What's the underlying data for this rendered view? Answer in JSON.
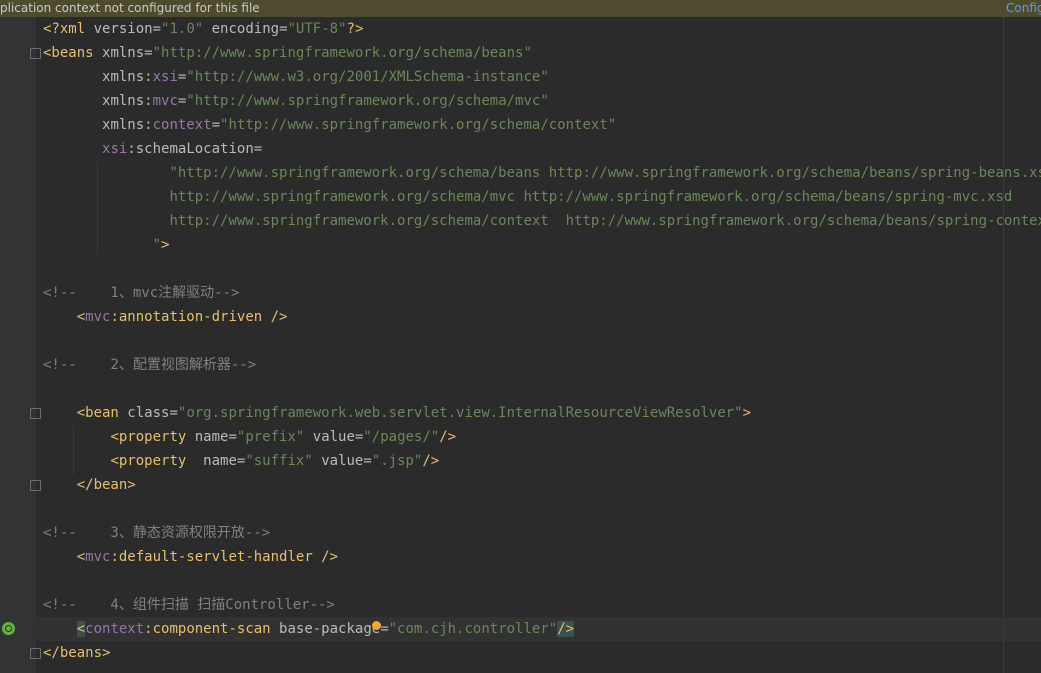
{
  "banner": {
    "message": "plication context not configured for this file",
    "configure_label": "Config"
  },
  "lines": [
    {
      "parts": [
        {
          "c": "tag",
          "t": "<?xml "
        },
        {
          "c": "attr",
          "t": "version"
        },
        {
          "c": "txt",
          "t": "="
        },
        {
          "c": "val",
          "t": "\"1.0\""
        },
        {
          "c": "txt",
          "t": " "
        },
        {
          "c": "attr",
          "t": "encoding"
        },
        {
          "c": "txt",
          "t": "="
        },
        {
          "c": "val",
          "t": "\"UTF-8\""
        },
        {
          "c": "tag",
          "t": "?>"
        }
      ]
    },
    {
      "parts": [
        {
          "c": "tag",
          "t": "<beans "
        },
        {
          "c": "attr",
          "t": "xmlns"
        },
        {
          "c": "txt",
          "t": "="
        },
        {
          "c": "val",
          "t": "\"http://www.springframework.org/schema/beans\""
        }
      ]
    },
    {
      "parts": [
        {
          "c": "txt",
          "t": "       "
        },
        {
          "c": "attr",
          "t": "xmlns:"
        },
        {
          "c": "ns",
          "t": "xsi"
        },
        {
          "c": "txt",
          "t": "="
        },
        {
          "c": "val",
          "t": "\"http://www.w3.org/2001/XMLSchema-instance\""
        }
      ]
    },
    {
      "parts": [
        {
          "c": "txt",
          "t": "       "
        },
        {
          "c": "attr",
          "t": "xmlns:"
        },
        {
          "c": "ns",
          "t": "mvc"
        },
        {
          "c": "txt",
          "t": "="
        },
        {
          "c": "val",
          "t": "\"http://www.springframework.org/schema/mvc\""
        }
      ]
    },
    {
      "parts": [
        {
          "c": "txt",
          "t": "       "
        },
        {
          "c": "attr",
          "t": "xmlns:"
        },
        {
          "c": "ns",
          "t": "context"
        },
        {
          "c": "txt",
          "t": "="
        },
        {
          "c": "val",
          "t": "\"http://www.springframework.org/schema/context\""
        }
      ]
    },
    {
      "parts": [
        {
          "c": "txt",
          "t": "       "
        },
        {
          "c": "ns",
          "t": "xsi"
        },
        {
          "c": "attr",
          "t": ":schemaLocation"
        },
        {
          "c": "txt",
          "t": "="
        }
      ]
    },
    {
      "parts": [
        {
          "c": "txt",
          "t": "               "
        },
        {
          "c": "val",
          "t": "\"http://www.springframework.org/schema/beans http://www.springframework.org/schema/beans/spring-beans.xsd"
        }
      ]
    },
    {
      "parts": [
        {
          "c": "txt",
          "t": "               "
        },
        {
          "c": "val",
          "t": "http://www.springframework.org/schema/mvc http://www.springframework.org/schema/beans/spring-mvc.xsd"
        }
      ]
    },
    {
      "parts": [
        {
          "c": "txt",
          "t": "               "
        },
        {
          "c": "val",
          "t": "http://www.springframework.org/schema/context  http://www.springframework.org/schema/beans/spring-context.xsd"
        }
      ]
    },
    {
      "parts": [
        {
          "c": "txt",
          "t": "             "
        },
        {
          "c": "val",
          "t": "\""
        },
        {
          "c": "tag",
          "t": ">"
        }
      ]
    },
    {
      "parts": []
    },
    {
      "parts": [
        {
          "c": "cmt",
          "t": "<!--    1、mvc注解驱动-->"
        }
      ]
    },
    {
      "parts": [
        {
          "c": "txt",
          "t": "    "
        },
        {
          "c": "tag",
          "t": "<"
        },
        {
          "c": "ns",
          "t": "mvc"
        },
        {
          "c": "tag",
          "t": ":annotation-driven />"
        }
      ]
    },
    {
      "parts": []
    },
    {
      "parts": [
        {
          "c": "cmt",
          "t": "<!--    2、配置视图解析器-->"
        }
      ]
    },
    {
      "parts": []
    },
    {
      "parts": [
        {
          "c": "txt",
          "t": "    "
        },
        {
          "c": "tag",
          "t": "<bean "
        },
        {
          "c": "attr",
          "t": "class"
        },
        {
          "c": "txt",
          "t": "="
        },
        {
          "c": "val",
          "t": "\"org.springframework.web.servlet.view.InternalResourceViewResolver\""
        },
        {
          "c": "tag",
          "t": ">"
        }
      ]
    },
    {
      "parts": [
        {
          "c": "txt",
          "t": "        "
        },
        {
          "c": "tag",
          "t": "<property "
        },
        {
          "c": "attr",
          "t": "name"
        },
        {
          "c": "txt",
          "t": "="
        },
        {
          "c": "val",
          "t": "\"prefix\""
        },
        {
          "c": "txt",
          "t": " "
        },
        {
          "c": "attr",
          "t": "value"
        },
        {
          "c": "txt",
          "t": "="
        },
        {
          "c": "val",
          "t": "\"/pages/\""
        },
        {
          "c": "tag",
          "t": "/>"
        }
      ]
    },
    {
      "parts": [
        {
          "c": "txt",
          "t": "        "
        },
        {
          "c": "tag",
          "t": "<property  "
        },
        {
          "c": "attr",
          "t": "name"
        },
        {
          "c": "txt",
          "t": "="
        },
        {
          "c": "val",
          "t": "\"suffix\""
        },
        {
          "c": "txt",
          "t": " "
        },
        {
          "c": "attr",
          "t": "value"
        },
        {
          "c": "txt",
          "t": "="
        },
        {
          "c": "val",
          "t": "\".jsp\""
        },
        {
          "c": "tag",
          "t": "/>"
        }
      ]
    },
    {
      "parts": [
        {
          "c": "txt",
          "t": "    "
        },
        {
          "c": "tag",
          "t": "</bean>"
        }
      ]
    },
    {
      "parts": []
    },
    {
      "parts": [
        {
          "c": "cmt",
          "t": "<!--    3、静态资源权限开放-->"
        }
      ]
    },
    {
      "parts": [
        {
          "c": "txt",
          "t": "    "
        },
        {
          "c": "tag",
          "t": "<"
        },
        {
          "c": "ns",
          "t": "mvc"
        },
        {
          "c": "tag",
          "t": ":default-servlet-handler />"
        }
      ]
    },
    {
      "parts": []
    },
    {
      "parts": [
        {
          "c": "cmt",
          "t": "<!--    4、组件扫描 扫描Controller-->"
        }
      ]
    },
    {
      "parts": [
        {
          "c": "txt",
          "t": "    "
        },
        {
          "c": "tag hl",
          "t": "<"
        },
        {
          "c": "ns",
          "t": "context"
        },
        {
          "c": "tag",
          "t": ":component-scan "
        },
        {
          "c": "attr",
          "t": "base-package"
        },
        {
          "c": "txt",
          "t": "="
        },
        {
          "c": "val",
          "t": "\"com.cjh.controller\""
        },
        {
          "c": "tag hl",
          "t": "/>"
        }
      ],
      "current": true
    },
    {
      "parts": [
        {
          "c": "tag",
          "t": "</beans>"
        }
      ]
    }
  ],
  "colors": {
    "background": "#2b2b2b",
    "tag": "#e8bf6a",
    "namespace": "#9876aa",
    "attribute": "#bababa",
    "string": "#6a8759",
    "comment": "#808080",
    "banner": "#4e4b2e",
    "link": "#589df6"
  },
  "icons": [
    "fold-marker-icon",
    "intention-bulb-icon",
    "spring-bean-gutter-icon"
  ]
}
